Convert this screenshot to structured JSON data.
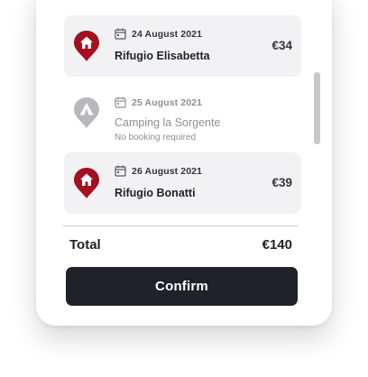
{
  "colors": {
    "booked_pin": "#a3101f",
    "unbooked_pin": "#b8b8bc",
    "button_bg": "#1f2229",
    "item_bg": "#f2f2f4"
  },
  "stays": [
    {
      "date": "24 August 2021",
      "name": "Rifugio Elisabetta",
      "price": "€34",
      "icon": "hut-pin-icon",
      "booked": true
    },
    {
      "date": "25 August 2021",
      "name": "Camping la Sorgente",
      "note": "No booking required",
      "icon": "tent-pin-icon",
      "booked": false
    },
    {
      "date": "26 August 2021",
      "name": "Rifugio Bonatti",
      "price": "€39",
      "icon": "hut-pin-icon",
      "booked": true
    }
  ],
  "summary": {
    "total_label": "Total",
    "total_value": "€140"
  },
  "confirm_label": "Confirm"
}
